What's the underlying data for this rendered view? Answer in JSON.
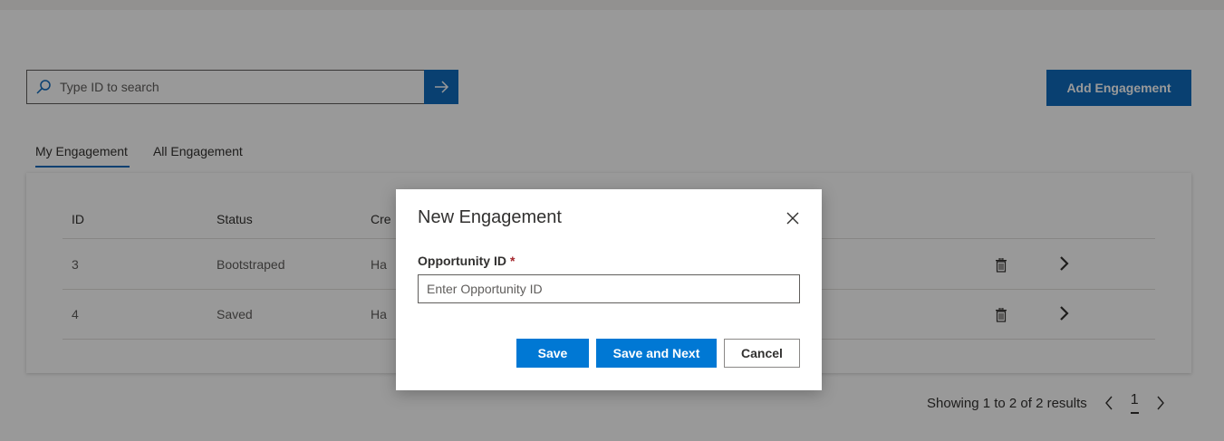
{
  "search": {
    "placeholder": "Type ID to search"
  },
  "header": {
    "add_label": "Add Engagement"
  },
  "tabs": [
    {
      "label": "My Engagement",
      "active": true
    },
    {
      "label": "All Engagement",
      "active": false
    }
  ],
  "table": {
    "columns": [
      "ID",
      "Status",
      "Cre"
    ],
    "rows": [
      {
        "id": "3",
        "status": "Bootstraped",
        "created": "Ha"
      },
      {
        "id": "4",
        "status": "Saved",
        "created": "Ha"
      }
    ]
  },
  "pagination": {
    "summary": "Showing 1 to 2 of 2 results",
    "current_page": "1"
  },
  "dialog": {
    "title": "New Engagement",
    "field_label": "Opportunity ID",
    "required_mark": "*",
    "field_placeholder": "Enter Opportunity ID",
    "save_label": "Save",
    "save_next_label": "Save and Next",
    "cancel_label": "Cancel"
  },
  "icons": {
    "search": "search-icon",
    "go": "arrow-right-icon",
    "delete": "trash-icon",
    "open": "chevron-right-icon",
    "close": "close-icon"
  },
  "colors": {
    "accent": "#0f6cbd",
    "primary_button": "#0078d4",
    "required": "#a4262c"
  }
}
